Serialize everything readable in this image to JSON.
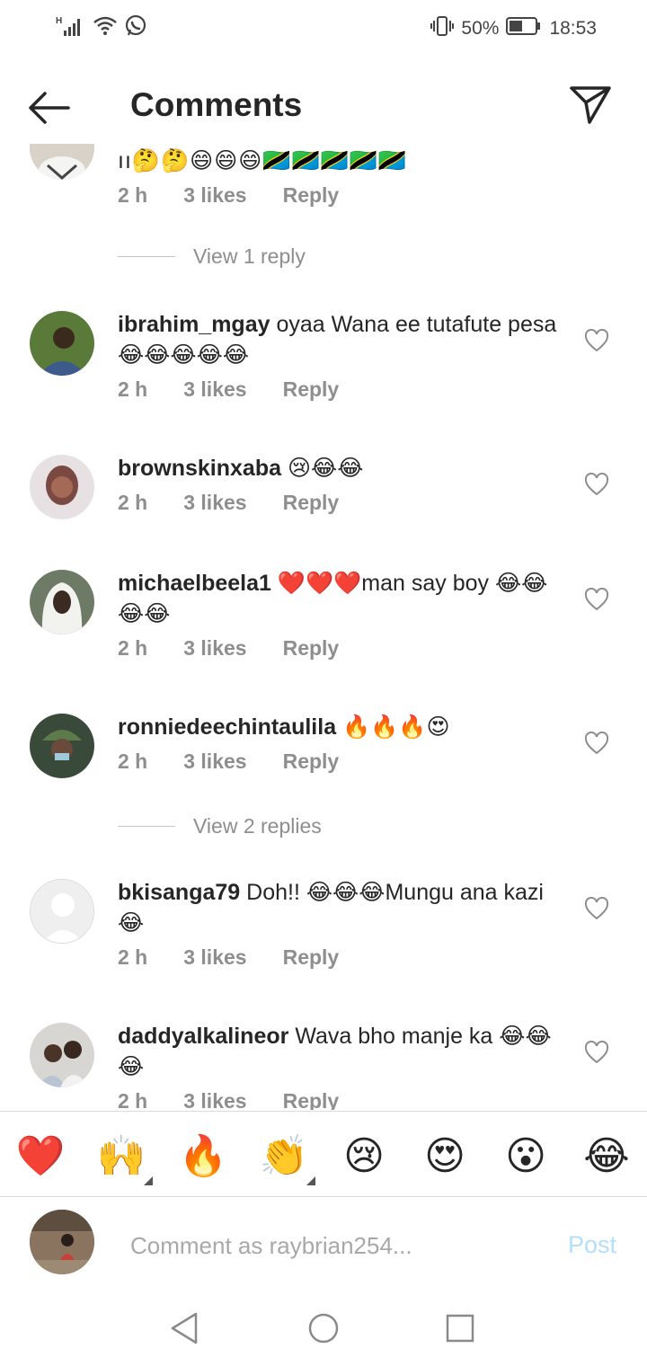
{
  "status_bar": {
    "signal_label": "H",
    "battery_percent": "50%",
    "time": "18:53",
    "icons": [
      "signal-icon",
      "wifi-icon",
      "whatsapp-icon",
      "vibrate-icon",
      "battery-icon"
    ]
  },
  "header": {
    "title": "Comments",
    "back_icon": "arrow-left-icon",
    "share_icon": "paper-plane-icon"
  },
  "partial_comment": {
    "text": "ıı🤔🤔😄😄😄🇹🇿🇹🇿🇹🇿🇹🇿🇹🇿",
    "time": "2 h",
    "likes": "3 likes",
    "reply": "Reply"
  },
  "view_replies_1": "View 1 reply",
  "view_replies_2": "View 2 replies",
  "comments": [
    {
      "username": "ibrahim_mgay",
      "text": "oyaa Wana ee tutafute pesa 😂😂😂😂😂",
      "time": "2 h",
      "likes": "3 likes",
      "reply": "Reply"
    },
    {
      "username": "brownskinxaba",
      "text": "😢😂😂",
      "time": "2 h",
      "likes": "3 likes",
      "reply": "Reply"
    },
    {
      "username": "michaelbeela1",
      "text": "❤️❤️❤️man say boy 😂😂😂😂",
      "time": "2 h",
      "likes": "3 likes",
      "reply": "Reply"
    },
    {
      "username": "ronniedeechintaulila",
      "text": "🔥🔥🔥😍",
      "time": "2 h",
      "likes": "3 likes",
      "reply": "Reply"
    },
    {
      "username": "bkisanga79",
      "text": "Doh!! 😂😂😂Mungu ana kazi😂",
      "time": "2 h",
      "likes": "3 likes",
      "reply": "Reply"
    },
    {
      "username": "daddyalkalineor",
      "text": "Wava bho manje ka 😂😂😂",
      "time": "2 h",
      "likes": "3 likes",
      "reply": "Reply"
    }
  ],
  "emoji_bar": [
    "❤️",
    "🙌",
    "🔥",
    "👏",
    "😢",
    "😍",
    "😮",
    "😂"
  ],
  "composer": {
    "placeholder": "Comment as raybrian254...",
    "post_label": "Post"
  },
  "colors": {
    "text": "#262626",
    "secondary": "#8e8e8e",
    "post_disabled": "#b2dffc",
    "heart_outline": "#8e8e8e"
  }
}
